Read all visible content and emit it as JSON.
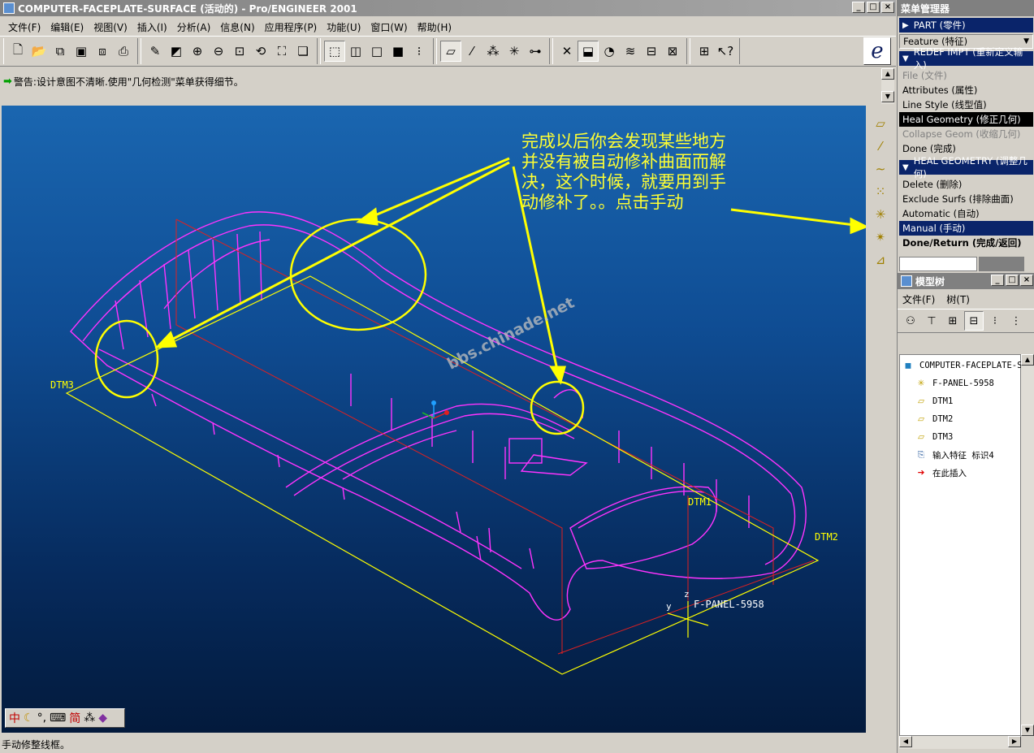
{
  "window": {
    "title": "COMPUTER-FACEPLATE-SURFACE (活动的) - Pro/ENGINEER 2001",
    "btn_min": "_",
    "btn_max": "□",
    "btn_close": "×"
  },
  "menubar": [
    "文件(F)",
    "编辑(E)",
    "视图(V)",
    "插入(I)",
    "分析(A)",
    "信息(N)",
    "应用程序(P)",
    "功能(U)",
    "窗口(W)",
    "帮助(H)"
  ],
  "message": {
    "text": "警告:设计意图不清晰.使用\"几何检测\"菜单获得细节。"
  },
  "viewport": {
    "annotation": [
      "完成以后你会发现某些地方",
      "并没有被自动修补曲面而解",
      "决，这个时候，就要用到手",
      "动修补了。。点击手动"
    ],
    "watermark": "bbs.chinade.net",
    "datum_labels": {
      "dtm1": "DTM1",
      "dtm2": "DTM2",
      "dtm3": "DTM3",
      "csys": "F-PANEL-5958",
      "axis_y": "y",
      "axis_z": "z"
    },
    "colors": {
      "wire": "#ff33ff",
      "datum": "#ffff00",
      "annotation": "#ffff33",
      "redline": "#e02020"
    }
  },
  "ime": {
    "lang": "中",
    "mode": "简"
  },
  "status": {
    "text": "手动修整线框。"
  },
  "menu_manager": {
    "title": "菜单管理器",
    "part_header": "PART (零件)",
    "feature_combo": "Feature (特征)",
    "redef_header": "REDEF IMPT (重新定义输入)",
    "redef_items": [
      {
        "label": "File (文件)",
        "state": "disabled"
      },
      {
        "label": "Attributes (属性)",
        "state": "normal"
      },
      {
        "label": "Line Style (线型值)",
        "state": "normal"
      },
      {
        "label": "Heal Geometry (修正几何)",
        "state": "selected"
      },
      {
        "label": "Collapse Geom (收缩几何)",
        "state": "disabled"
      },
      {
        "label": "Done (完成)",
        "state": "normal"
      }
    ],
    "heal_header": "HEAL GEOMETRY (调整几何)",
    "heal_items": [
      {
        "label": "Delete (删除)",
        "state": "normal"
      },
      {
        "label": "Exclude Surfs (排除曲面)",
        "state": "normal"
      },
      {
        "label": "Automatic (自动)",
        "state": "normal"
      },
      {
        "label": "Manual (手动)",
        "state": "highlight"
      },
      {
        "label": "Done/Return (完成/返回)",
        "state": "bold"
      }
    ]
  },
  "model_tree": {
    "title": "模型树",
    "menu": [
      "文件(F)",
      "树(T)"
    ],
    "root": "COMPUTER-FACEPLATE-SU",
    "items": [
      {
        "label": "F-PANEL-5958",
        "icon": "csys-icon"
      },
      {
        "label": "DTM1",
        "icon": "datum-plane-icon"
      },
      {
        "label": "DTM2",
        "icon": "datum-plane-icon"
      },
      {
        "label": "DTM3",
        "icon": "datum-plane-icon"
      },
      {
        "label": "输入特征 标识4",
        "icon": "import-feature-icon"
      },
      {
        "label": "在此插入",
        "icon": "insert-arrow-icon"
      }
    ]
  }
}
